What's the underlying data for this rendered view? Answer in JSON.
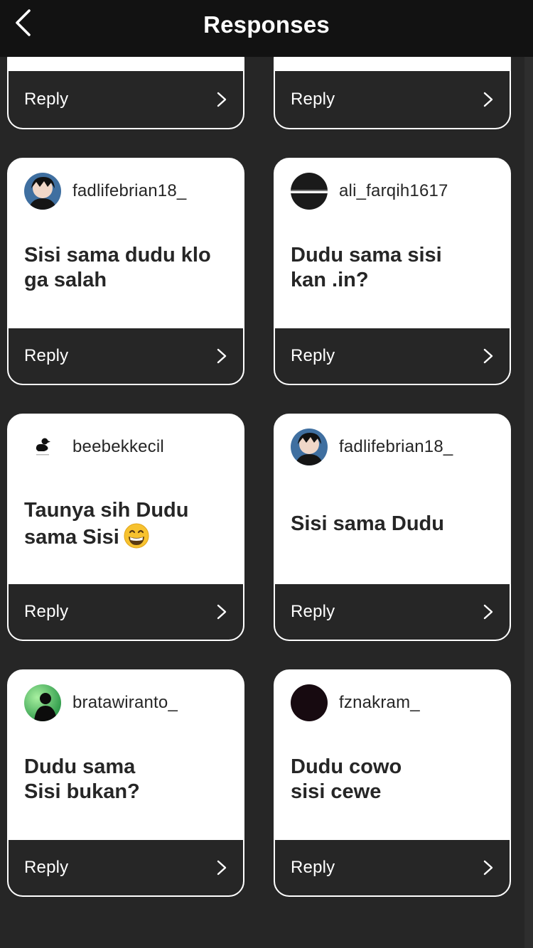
{
  "header": {
    "title": "Responses",
    "back_icon": "chevron-left-icon"
  },
  "colors": {
    "background": "#262626",
    "header": "#121212",
    "card": "#ffffff",
    "reply_bar": "#262626"
  },
  "partial_cards": [
    {
      "reply_label": "Reply"
    },
    {
      "reply_label": "Reply"
    }
  ],
  "responses": [
    {
      "username": "fadlifebrian18_",
      "answer": "Sisi sama dudu klo\nga salah",
      "reply_label": "Reply",
      "avatar": "anime-avatar"
    },
    {
      "username": "ali_farqih1617",
      "answer": "Dudu sama sisi\nkan .in?",
      "reply_label": "Reply",
      "avatar": "dark-avatar"
    },
    {
      "username": "beebekkecil",
      "answer": "Taunya sih Dudu\nsama Sisi",
      "answer_emoji": "grinning-face-emoji",
      "reply_label": "Reply",
      "avatar": "duck-avatar"
    },
    {
      "username": "fadlifebrian18_",
      "answer": "Sisi sama Dudu",
      "reply_label": "Reply",
      "avatar": "anime-avatar"
    },
    {
      "username": "bratawiranto_",
      "answer": "Dudu sama\nSisi bukan?",
      "reply_label": "Reply",
      "avatar": "silhouette-avatar"
    },
    {
      "username": "fznakram_",
      "answer": "Dudu cowo\nsisi cewe",
      "reply_label": "Reply",
      "avatar": "black-avatar"
    }
  ]
}
